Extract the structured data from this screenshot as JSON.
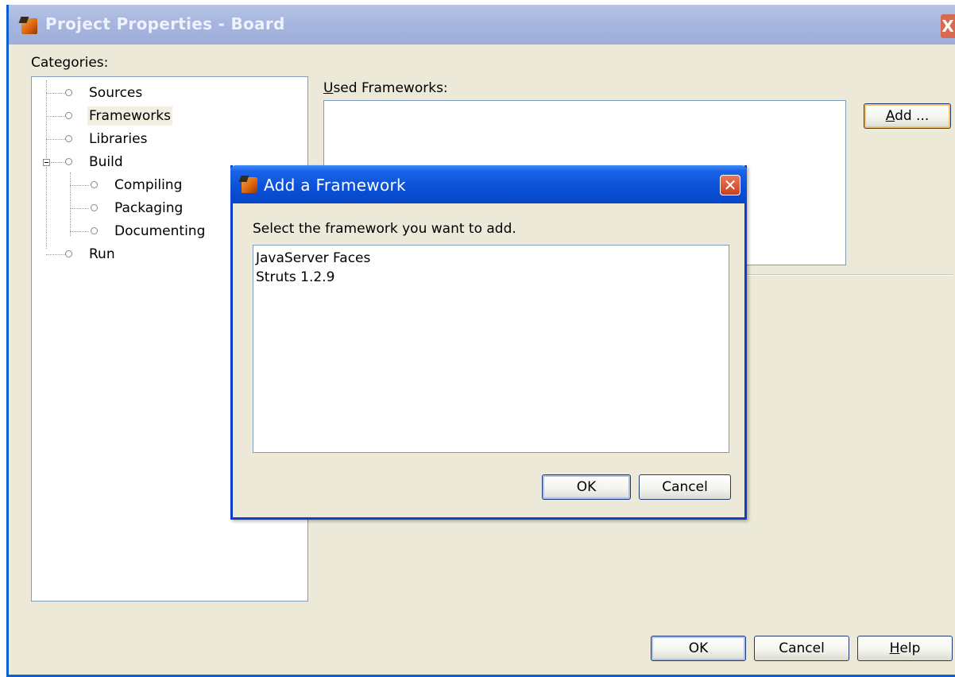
{
  "main_window": {
    "title": "Project Properties - Board",
    "close_glyph": "X",
    "categories_label": "Categories:",
    "tree": [
      {
        "label": "Sources"
      },
      {
        "label": "Frameworks",
        "selected": true
      },
      {
        "label": "Libraries"
      },
      {
        "label": "Build",
        "expanded": true
      },
      {
        "label": "Compiling",
        "child": true
      },
      {
        "label": "Packaging",
        "child": true
      },
      {
        "label": "Documenting",
        "child": true
      },
      {
        "label": "Run"
      }
    ],
    "used_frameworks_label_mnemonic": "U",
    "used_frameworks_label_rest": "sed Frameworks:",
    "add_button_mnemonic": "A",
    "add_button_rest": "dd ...",
    "ok_label": "OK",
    "cancel_label": "Cancel",
    "help_mnemonic": "H",
    "help_rest": "elp"
  },
  "dialog": {
    "title": "Add a Framework",
    "close_glyph": "✕",
    "prompt": "Select the framework you want to add.",
    "frameworks": [
      "JavaServer Faces",
      "Struts 1.2.9"
    ],
    "ok_label": "OK",
    "cancel_label": "Cancel"
  },
  "colors": {
    "dialog_titlebar": "#0a50d8",
    "window_background": "#ece9d8",
    "close_button": "#c9401f"
  }
}
